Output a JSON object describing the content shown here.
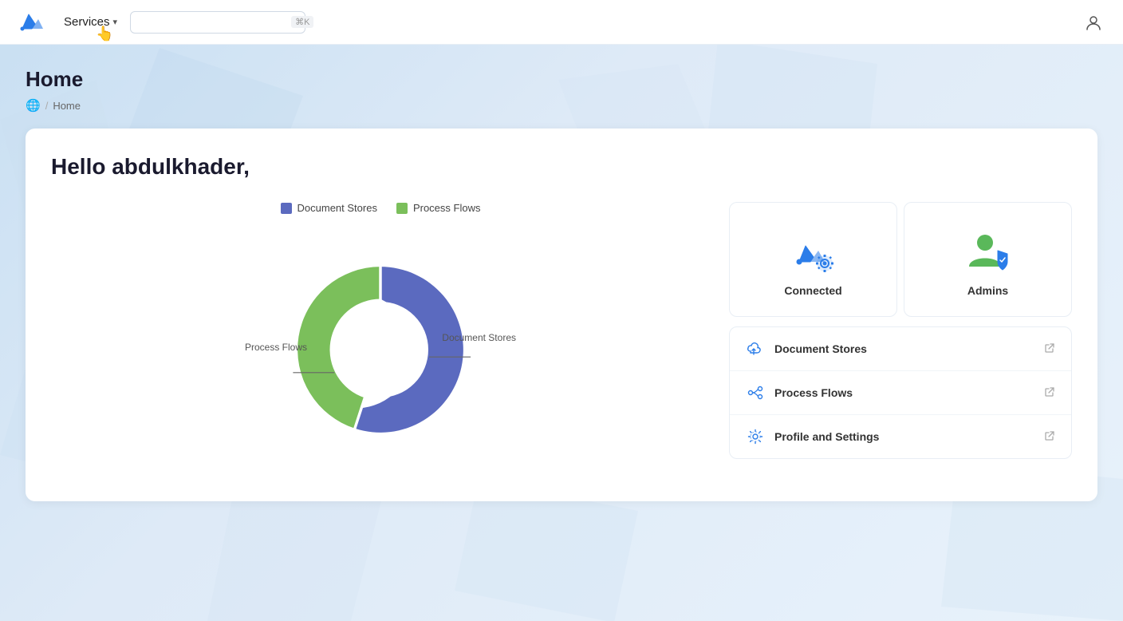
{
  "topbar": {
    "services_label": "Services",
    "search_placeholder": "",
    "search_shortcut": "⌘K"
  },
  "breadcrumb": {
    "home_label": "Home",
    "separator": "/"
  },
  "page": {
    "title": "Home",
    "greeting": "Hello abdulkhader,"
  },
  "chart": {
    "legend": [
      {
        "label": "Document Stores",
        "color": "#5b6abf"
      },
      {
        "label": "Process Flows",
        "color": "#7bbf5b"
      }
    ],
    "label_process": "Process Flows",
    "label_document": "Document Stores",
    "document_percent": 55,
    "process_percent": 45
  },
  "status_cards": [
    {
      "label": "Connected"
    },
    {
      "label": "Admins"
    }
  ],
  "links": [
    {
      "label": "Document Stores",
      "icon": "cloud"
    },
    {
      "label": "Process Flows",
      "icon": "flows"
    },
    {
      "label": "Profile and Settings",
      "icon": "settings"
    }
  ]
}
